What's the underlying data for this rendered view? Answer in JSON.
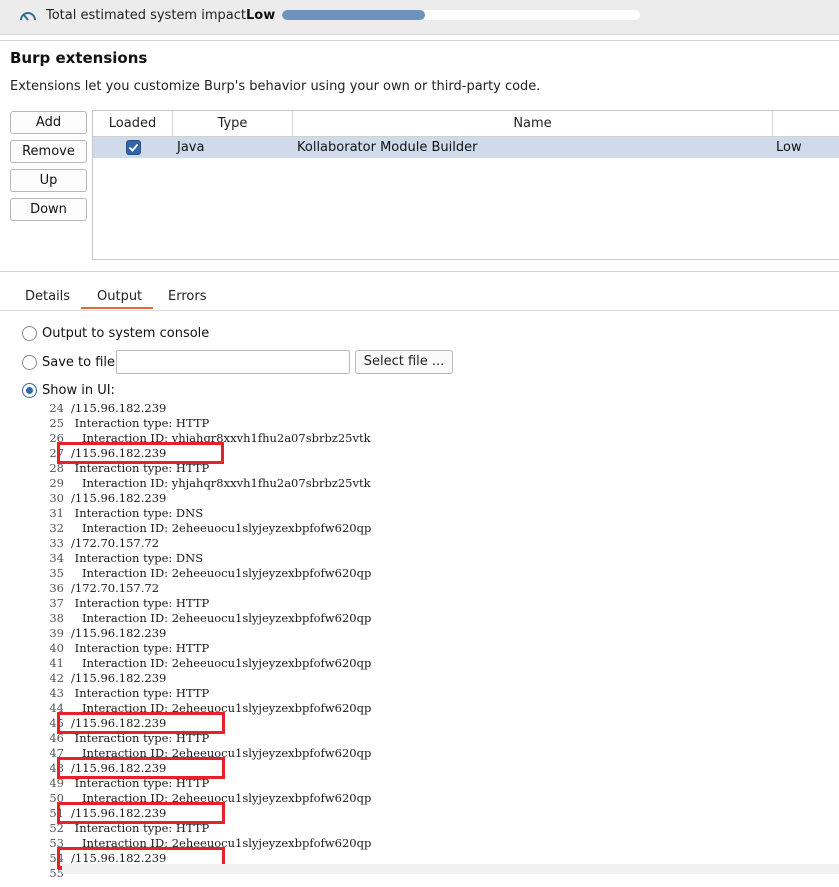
{
  "impact": {
    "label": "Total estimated system impact:",
    "level": "Low",
    "fraction": 0.4,
    "icon": "gauge-icon",
    "fill_color": "#6c92bf"
  },
  "section": {
    "title": "Burp extensions",
    "description": "Extensions let you customize Burp's behavior using your own or third-party code."
  },
  "buttons": {
    "add": "Add",
    "remove": "Remove",
    "up": "Up",
    "down": "Down"
  },
  "table": {
    "columns": [
      "Loaded",
      "Type",
      "Name"
    ],
    "rows": [
      {
        "loaded": true,
        "type": "Java",
        "name": "Kollaborator Module Builder",
        "impact": "Low"
      }
    ],
    "selected_color": "#cfdbeb"
  },
  "tabs": [
    {
      "label": "Details",
      "active": false
    },
    {
      "label": "Output",
      "active": true
    },
    {
      "label": "Errors",
      "active": false
    }
  ],
  "output": {
    "system_console": "Output to system console",
    "save_to_file": "Save to file:",
    "file_value": "",
    "select_file": "Select file ...",
    "show_in_ui": "Show in UI:",
    "selected_option": "Show in UI:"
  },
  "log_lines": [
    {
      "n": "24",
      "t": "/115.96.182.239"
    },
    {
      "n": "25",
      "t": " Interaction type: HTTP"
    },
    {
      "n": "26",
      "t": "   Interaction ID: yhjahqr8xxvh1fhu2a07sbrbz25vtk"
    },
    {
      "n": "27",
      "t": "/115.96.182.239"
    },
    {
      "n": "28",
      "t": " Interaction type: HTTP"
    },
    {
      "n": "29",
      "t": "   Interaction ID: yhjahqr8xxvh1fhu2a07sbrbz25vtk"
    },
    {
      "n": "30",
      "t": "/115.96.182.239"
    },
    {
      "n": "31",
      "t": " Interaction type: DNS"
    },
    {
      "n": "32",
      "t": "   Interaction ID: 2eheeuocu1slyjeyzexbpfofw620qp"
    },
    {
      "n": "33",
      "t": "/172.70.157.72"
    },
    {
      "n": "34",
      "t": " Interaction type: DNS"
    },
    {
      "n": "35",
      "t": "   Interaction ID: 2eheeuocu1slyjeyzexbpfofw620qp"
    },
    {
      "n": "36",
      "t": "/172.70.157.72"
    },
    {
      "n": "37",
      "t": " Interaction type: HTTP"
    },
    {
      "n": "38",
      "t": "   Interaction ID: 2eheeuocu1slyjeyzexbpfofw620qp"
    },
    {
      "n": "39",
      "t": "/115.96.182.239"
    },
    {
      "n": "40",
      "t": " Interaction type: HTTP"
    },
    {
      "n": "41",
      "t": "   Interaction ID: 2eheeuocu1slyjeyzexbpfofw620qp"
    },
    {
      "n": "42",
      "t": "/115.96.182.239"
    },
    {
      "n": "43",
      "t": " Interaction type: HTTP"
    },
    {
      "n": "44",
      "t": "   Interaction ID: 2eheeuocu1slyjeyzexbpfofw620qp"
    },
    {
      "n": "45",
      "t": "/115.96.182.239"
    },
    {
      "n": "46",
      "t": " Interaction type: HTTP"
    },
    {
      "n": "47",
      "t": "   Interaction ID: 2eheeuocu1slyjeyzexbpfofw620qp"
    },
    {
      "n": "48",
      "t": "/115.96.182.239"
    },
    {
      "n": "49",
      "t": " Interaction type: HTTP"
    },
    {
      "n": "50",
      "t": "   Interaction ID: 2eheeuocu1slyjeyzexbpfofw620qp"
    },
    {
      "n": "51",
      "t": "/115.96.182.239"
    },
    {
      "n": "52",
      "t": " Interaction type: HTTP"
    },
    {
      "n": "53",
      "t": "   Interaction ID: 2eheeuocu1slyjeyzexbpfofw620qp"
    },
    {
      "n": "54",
      "t": "/115.96.182.239"
    },
    {
      "n": "55",
      "t": ""
    }
  ],
  "highlighted_line_numbers": [
    "27",
    "45",
    "48",
    "51",
    "54"
  ],
  "highlight_color": "#e8202a"
}
